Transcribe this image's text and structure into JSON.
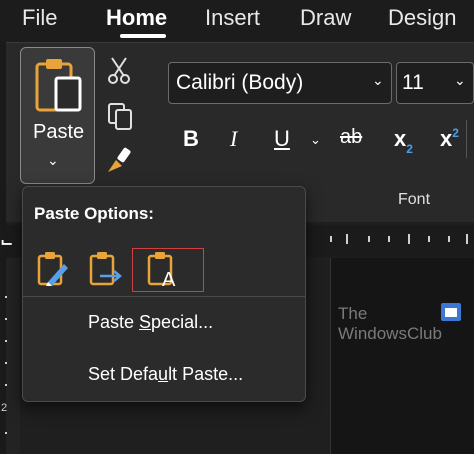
{
  "tabs": [
    "File",
    "Home",
    "Insert",
    "Draw",
    "Design"
  ],
  "active_tab": "Home",
  "clipboard": {
    "paste_label": "Paste",
    "cut_icon": "scissors-icon",
    "copy_icon": "copy-icon",
    "format_painter_icon": "brush-icon"
  },
  "font": {
    "family": "Calibri (Body)",
    "size": "11",
    "bold": "B",
    "italic": "I",
    "underline": "U",
    "strikethrough": "ab",
    "subscript": "x",
    "subscript_mark": "2",
    "superscript": "x",
    "superscript_mark": "2",
    "group_label": "Font"
  },
  "paste_menu": {
    "title": "Paste Options:",
    "options": [
      {
        "name": "keep-source-formatting",
        "icon": "paste-keep-source-icon"
      },
      {
        "name": "merge-formatting",
        "icon": "paste-merge-icon"
      },
      {
        "name": "keep-text-only",
        "icon": "paste-text-only-icon",
        "selected": true
      }
    ],
    "items": [
      {
        "before": "Paste ",
        "underline": "S",
        "after": "pecial..."
      },
      {
        "before": "Set Defa",
        "underline": "u",
        "after": "lt Paste..."
      }
    ]
  },
  "watermark": {
    "line1": "The",
    "line2": "WindowsClub"
  },
  "vertical_ruler_number": "2",
  "colors": {
    "clipboard_orange": "#e8a33a",
    "selection_border": "#d04040",
    "watermark_blue": "#3a78d4",
    "ribbon_bg": "#292929"
  }
}
